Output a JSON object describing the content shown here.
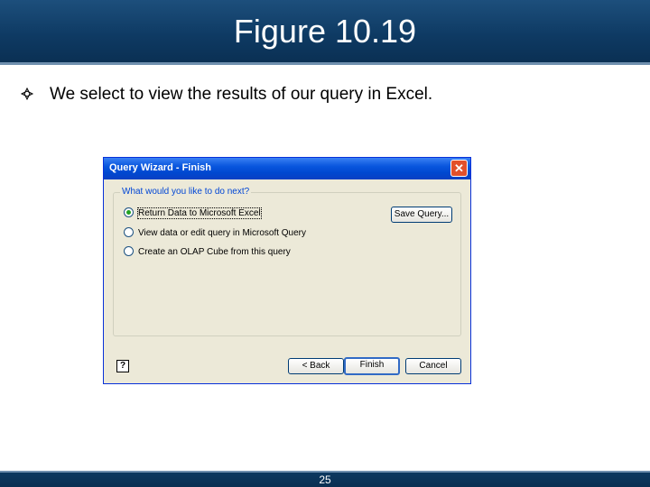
{
  "slide": {
    "title": "Figure 10.19",
    "bullet_text": "We select to view the results of our query in Excel.",
    "page_number": "25"
  },
  "dialog": {
    "title": "Query Wizard - Finish",
    "close_icon": "close-icon",
    "group_label": "What would you like to do next?",
    "options": [
      "Return Data to Microsoft Excel",
      "View data or edit query in Microsoft Query",
      "Create an OLAP Cube from this query"
    ],
    "selected_option": "Return Data to Microsoft Excel",
    "save_query_label": "Save Query...",
    "back_label": "< Back",
    "finish_label": "Finish",
    "cancel_label": "Cancel",
    "help_icon": "help-icon",
    "help_label": "?"
  },
  "colors": {
    "title_bar": "#0e3a63",
    "dialog_title": "#0855dd",
    "dialog_body": "#ece9d8"
  }
}
